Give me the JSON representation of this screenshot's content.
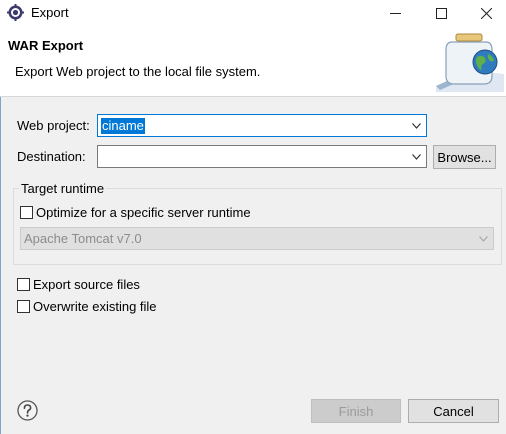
{
  "window": {
    "title": "Export"
  },
  "banner": {
    "title": "WAR Export",
    "description": "Export Web project to the local file system."
  },
  "form": {
    "web_project_label": "Web project:",
    "web_project_value": "ciname",
    "destination_label": "Destination:",
    "destination_value": "",
    "browse_label": "Browse..."
  },
  "target_runtime": {
    "group_title": "Target runtime",
    "optimize_label": "Optimize for a specific server runtime",
    "optimize_checked": false,
    "runtime_value": "Apache Tomcat v7.0"
  },
  "options": {
    "export_source_label": "Export source files",
    "export_source_checked": false,
    "overwrite_label": "Overwrite existing file",
    "overwrite_checked": false
  },
  "footer": {
    "finish_label": "Finish",
    "cancel_label": "Cancel"
  },
  "icons": {
    "app": "eclipse-gear-icon",
    "banner": "jar-globe-icon",
    "help": "help-icon"
  },
  "colors": {
    "focus": "#0078d7",
    "dialog_bg": "#f0f0f0",
    "banner_bg": "#ffffff"
  }
}
